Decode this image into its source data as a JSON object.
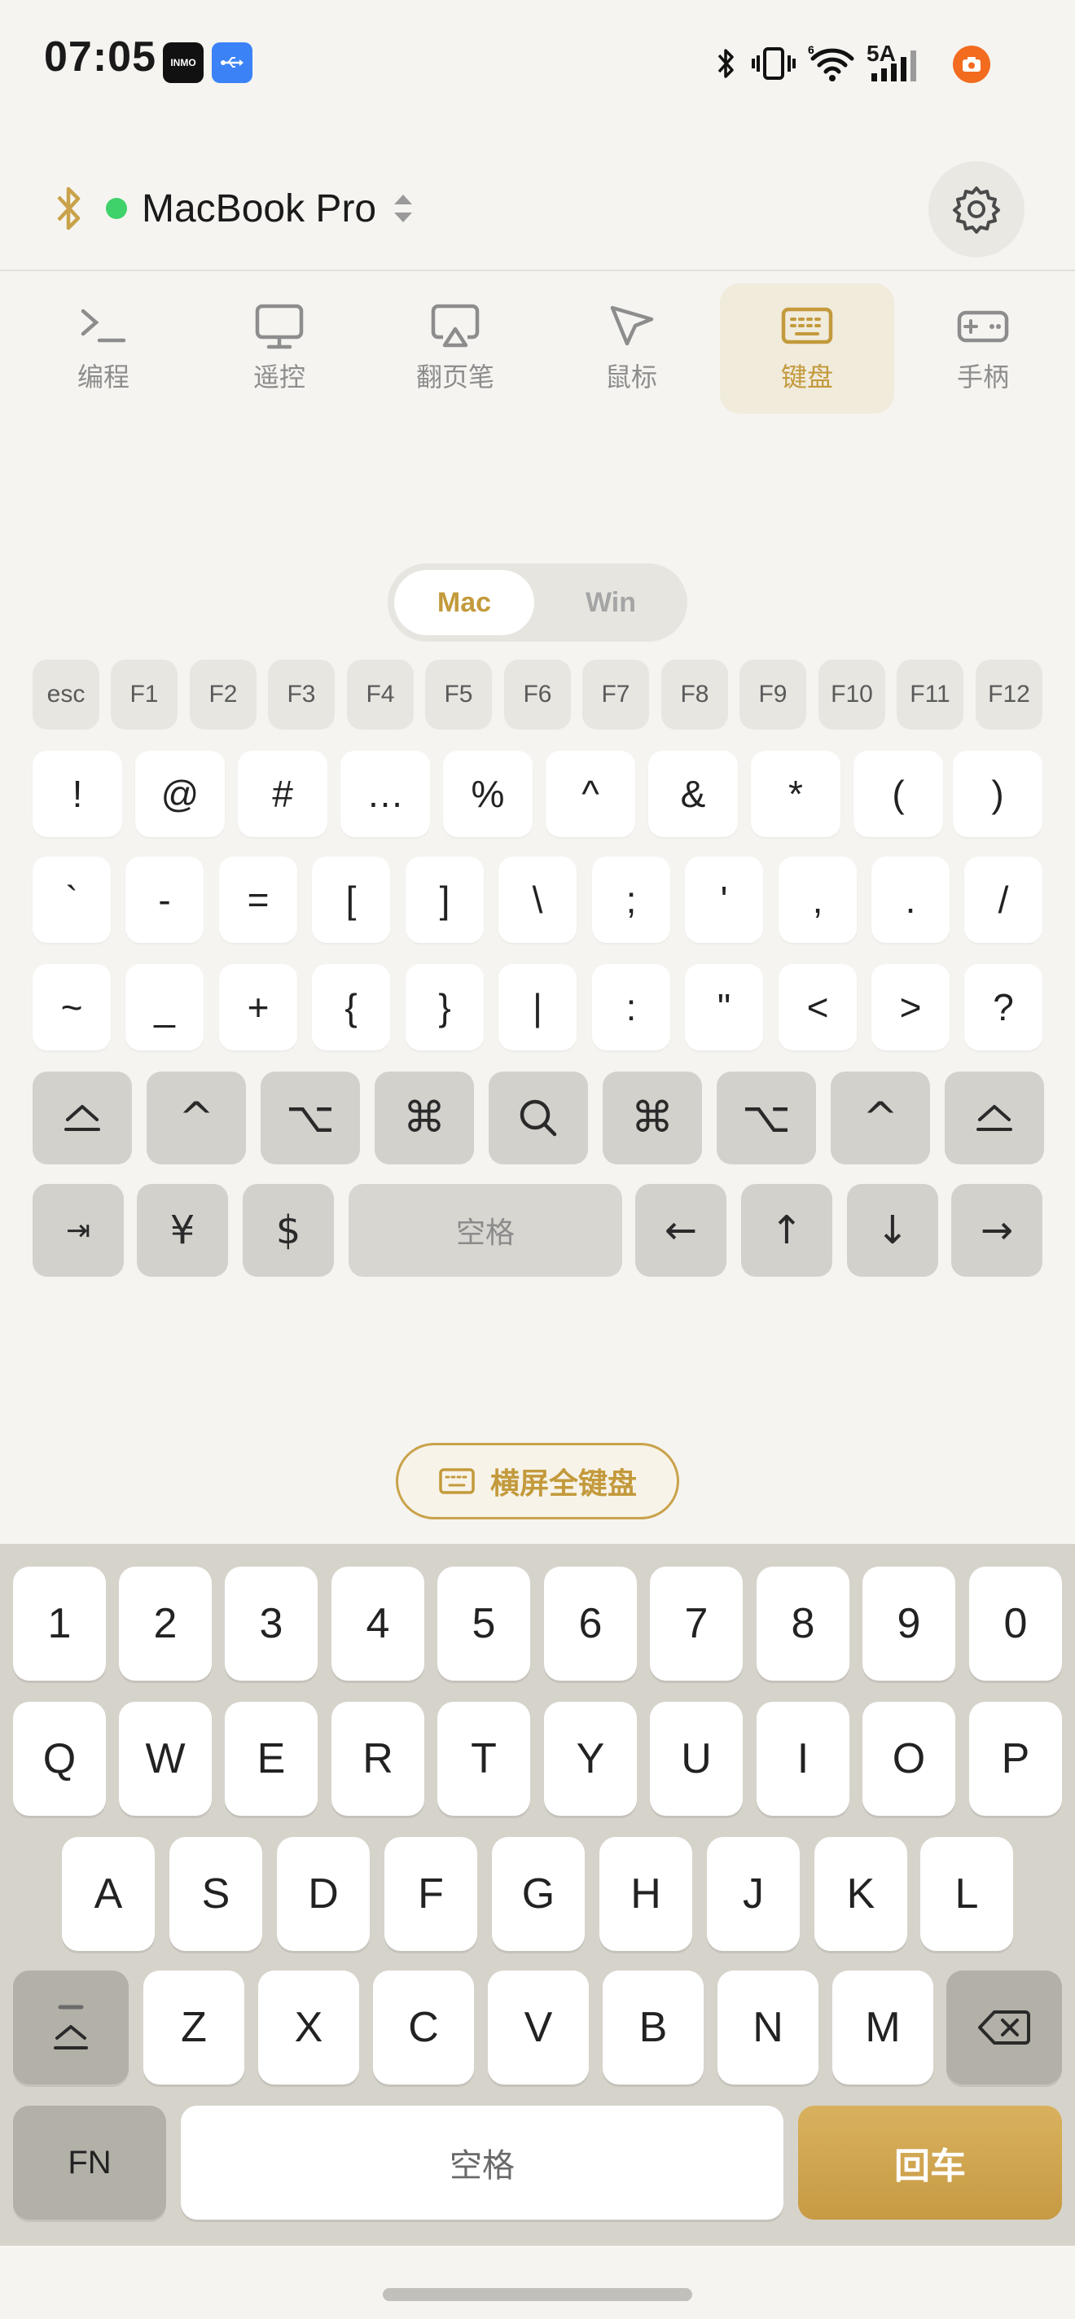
{
  "status_bar": {
    "time": "07:05",
    "inmo_badge": "INMO",
    "network_label": "5A"
  },
  "header": {
    "device_name": "MacBook Pro",
    "connection_color": "#3fd26b"
  },
  "tabs": [
    {
      "label": "编程",
      "icon": "terminal-icon"
    },
    {
      "label": "遥控",
      "icon": "monitor-icon"
    },
    {
      "label": "翻页笔",
      "icon": "airplay-icon"
    },
    {
      "label": "鼠标",
      "icon": "cursor-icon"
    },
    {
      "label": "键盘",
      "icon": "keyboard-icon",
      "active": true
    },
    {
      "label": "手柄",
      "icon": "gamepad-icon"
    }
  ],
  "os_toggle": {
    "mac": "Mac",
    "win": "Win",
    "selected": "Mac"
  },
  "fn_keys": [
    "esc",
    "F1",
    "F2",
    "F3",
    "F4",
    "F5",
    "F6",
    "F7",
    "F8",
    "F9",
    "F10",
    "F11",
    "F12"
  ],
  "symbol_row1": [
    "!",
    "@",
    "#",
    "…",
    "%",
    "^",
    "&",
    "*",
    "(",
    ")"
  ],
  "symbol_row2": [
    "`",
    "-",
    "=",
    "[",
    "]",
    "\\",
    ";",
    "'",
    ",",
    ".",
    "/"
  ],
  "symbol_row3": [
    "~",
    "_",
    "+",
    "{",
    "}",
    "|",
    ":",
    "\"",
    "<",
    ">",
    "?"
  ],
  "modifier_row": [
    "⏏",
    "^",
    "⌥",
    "⌘",
    "search",
    "⌘",
    "⌥",
    "^",
    "⏏"
  ],
  "nav_row": {
    "tab": "⇥",
    "yen": "¥",
    "dollar": "$",
    "space": "空格",
    "left": "←",
    "up": "↑",
    "down": "↓",
    "right": "→"
  },
  "landscape_button": "横屏全键盘",
  "ime": {
    "digits": [
      "1",
      "2",
      "3",
      "4",
      "5",
      "6",
      "7",
      "8",
      "9",
      "0"
    ],
    "row_q": [
      "Q",
      "W",
      "E",
      "R",
      "T",
      "Y",
      "U",
      "I",
      "O",
      "P"
    ],
    "row_a": [
      "A",
      "S",
      "D",
      "F",
      "G",
      "H",
      "J",
      "K",
      "L"
    ],
    "row_z": [
      "Z",
      "X",
      "C",
      "V",
      "B",
      "N",
      "M"
    ],
    "fn": "FN",
    "space": "空格",
    "enter": "回车"
  }
}
